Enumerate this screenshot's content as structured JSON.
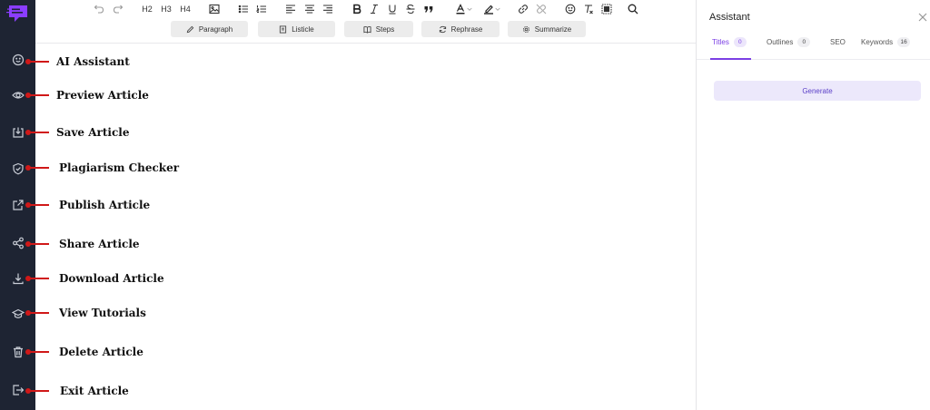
{
  "toolbar": {
    "headings": [
      "H2",
      "H3",
      "H4"
    ],
    "icons": [
      "undo-icon",
      "redo-icon",
      "image-icon",
      "bullet-list-icon",
      "numbered-list-icon",
      "align-left-icon",
      "align-center-icon",
      "align-right-icon",
      "bold-icon",
      "italic-icon",
      "underline-icon",
      "strikethrough-icon",
      "blockquote-icon",
      "text-color-icon",
      "highlight-icon",
      "link-icon",
      "unlink-icon",
      "emoji-icon",
      "clear-format-icon",
      "select-all-icon",
      "search-icon"
    ],
    "actions": [
      {
        "label": "Paragraph",
        "icon": "pencil-icon"
      },
      {
        "label": "Listicle",
        "icon": "list-box-icon"
      },
      {
        "label": "Steps",
        "icon": "book-icon"
      },
      {
        "label": "Rephrase",
        "icon": "refresh-icon"
      },
      {
        "label": "Summarize",
        "icon": "gear-icon"
      }
    ]
  },
  "sidebar": {
    "items": [
      {
        "label": "AI Assistant",
        "icon": "smile-icon"
      },
      {
        "label": "Preview Article",
        "icon": "eye-icon"
      },
      {
        "label": "Save Article",
        "icon": "save-icon"
      },
      {
        "label": "Plagiarism Checker",
        "icon": "shield-check-icon"
      },
      {
        "label": "Publish Article",
        "icon": "external-link-icon"
      },
      {
        "label": "Share Article",
        "icon": "share-icon"
      },
      {
        "label": "Download Article",
        "icon": "download-icon"
      },
      {
        "label": "View Tutorials",
        "icon": "graduation-cap-icon"
      },
      {
        "label": "Delete Article",
        "icon": "trash-icon"
      },
      {
        "label": "Exit Article",
        "icon": "exit-icon"
      }
    ]
  },
  "panel": {
    "title": "Assistant",
    "tabs": [
      {
        "label": "Titles",
        "badge": "0",
        "active": true
      },
      {
        "label": "Outlines",
        "badge": "0",
        "active": false
      },
      {
        "label": "SEO",
        "badge": null,
        "active": false
      },
      {
        "label": "Keywords",
        "badge": "16",
        "active": false
      }
    ],
    "generate_label": "Generate"
  },
  "colors": {
    "sidebar_bg": "#1e2433",
    "accent": "#7b3fe4",
    "annotation_red": "#d01818",
    "logo": "#8b3dff"
  }
}
